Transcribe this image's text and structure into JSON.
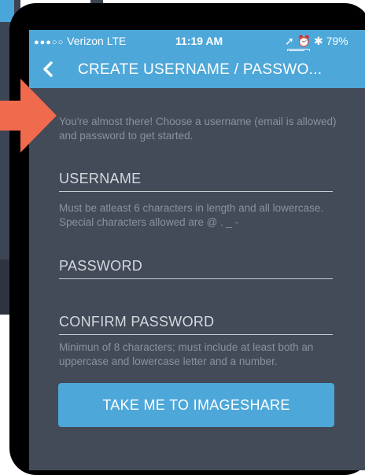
{
  "status_bar": {
    "carrier": "Verizon",
    "network": "LTE",
    "time": "11:19 AM",
    "battery": "79%",
    "battery_level": 0.79
  },
  "nav": {
    "title": "CREATE USERNAME / PASSWO..."
  },
  "intro_text": "You're almost there! Choose a username (email is allowed) and password to get started.",
  "fields": {
    "username": {
      "label": "USERNAME",
      "hint": "Must be atleast 6 characters in length and all lowercase. Special characters allowed are @ . _ -"
    },
    "password": {
      "label": "PASSWORD"
    },
    "confirm_password": {
      "label": "CONFIRM PASSWORD",
      "hint": "Minimun of 8 characters; must include at least both an uppercase and lowercase letter and a number."
    }
  },
  "cta_label": "TAKE ME TO IMAGESHARE",
  "colors": {
    "brand_blue": "#4ea7d9",
    "screen_bg": "#434a58",
    "annotation_arrow": "#f06a4d"
  }
}
